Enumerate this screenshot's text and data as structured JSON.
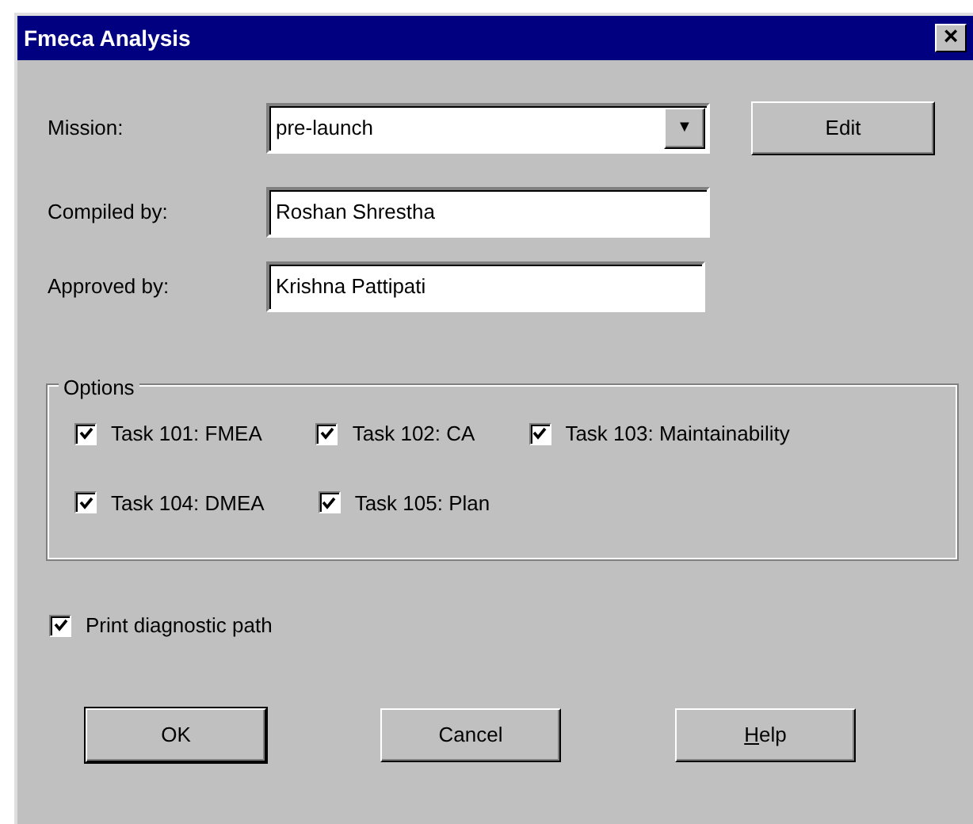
{
  "window": {
    "title": "Fmeca Analysis",
    "close": "×"
  },
  "fields": [
    {
      "kind": "combo",
      "label": "Mission:",
      "value": "pre-launch",
      "arrow": "▼"
    },
    {
      "kind": "text",
      "label": "Compiled by:",
      "value": "Roshan Shrestha"
    },
    {
      "kind": "text",
      "label": "Approved by:",
      "value": "Krishna Pattipati"
    }
  ],
  "edit_button": "Edit",
  "options": {
    "title": "Options",
    "rows": [
      [
        {
          "label": "Task 101: FMEA",
          "checked": true
        },
        {
          "label": "Task 102: CA",
          "checked": true
        },
        {
          "label": "Task 103: Maintainability",
          "checked": true
        }
      ],
      [
        {
          "label": "Task 104: DMEA",
          "checked": true
        },
        {
          "label": "Task 105: Plan",
          "checked": true
        }
      ]
    ]
  },
  "print_path": {
    "label": "Print diagnostic path",
    "checked": true
  },
  "buttons": [
    {
      "label": "OK",
      "default": true,
      "mnemonic": false
    },
    {
      "label": "Cancel",
      "default": false,
      "mnemonic": false
    },
    {
      "label": "Help",
      "default": false,
      "mnemonic": true
    }
  ]
}
